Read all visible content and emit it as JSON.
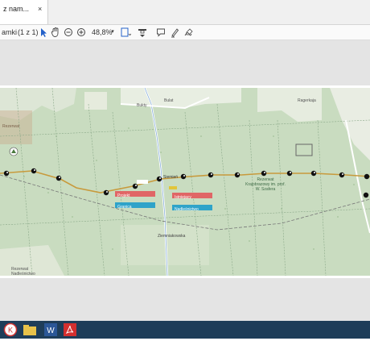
{
  "tab": {
    "title": "z nam...",
    "close": "×"
  },
  "toolbar": {
    "left_label": "amki",
    "page_info": "(1 z 1)",
    "zoom": "48,8%",
    "icons": [
      "cursor-icon",
      "hand-icon",
      "zoom-out-icon",
      "zoom-in-icon",
      "fit-page-icon",
      "scroll-icon",
      "comment-icon",
      "highlight-icon",
      "sign-icon"
    ]
  },
  "map": {
    "labels": {
      "top_road": "Bukty",
      "top_road2": "Bulat",
      "top_right_town": "Ragerkaja",
      "center_road": "Siemień",
      "bottom_road": "Ziemniakowska",
      "reserve": "Rezerwat Krajobrazowy im. prof. W. Szafera",
      "bottom_left": "Rezerwat Nadleśnictwo",
      "left_area": "Rezerwat"
    },
    "legend": {
      "red_left": "Projekt",
      "red_right": "Istniejący",
      "blue_left": "Granica",
      "blue_right": "Nadleśnictwo"
    },
    "route_color": "#c89a3c",
    "marker_color": "#111111"
  },
  "taskbar": {
    "apps": [
      "app-icon",
      "explorer-icon",
      "word-icon",
      "acrobat-icon"
    ]
  }
}
